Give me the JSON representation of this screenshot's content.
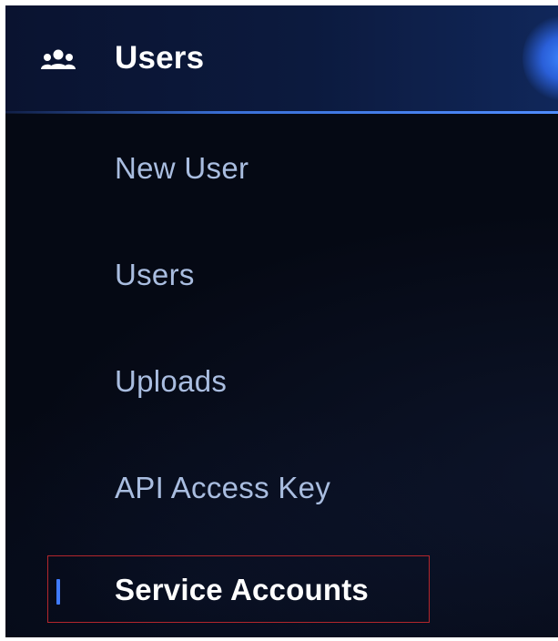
{
  "section": {
    "title": "Users",
    "icon": "users-group-icon"
  },
  "menu": {
    "items": [
      {
        "label": "New User"
      },
      {
        "label": "Users"
      },
      {
        "label": "Uploads"
      },
      {
        "label": "API Access Key"
      },
      {
        "label": "Service Accounts",
        "active": true
      }
    ]
  },
  "colors": {
    "background": "#050914",
    "header": "#0c1a3e",
    "item_text": "#a9bde0",
    "active_text": "#ffffff",
    "active_indicator": "#3f7bff",
    "selection_border": "#b3262c"
  }
}
